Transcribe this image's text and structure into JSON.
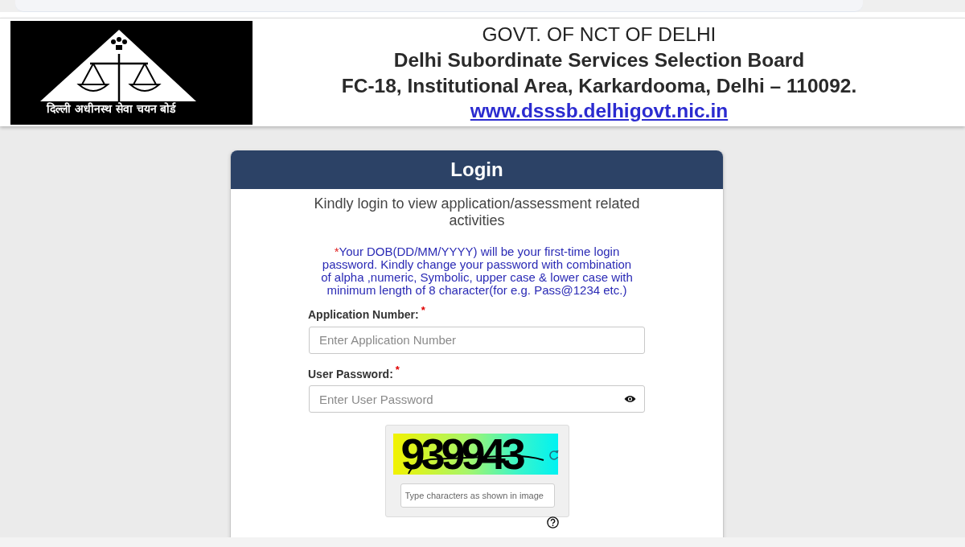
{
  "header": {
    "logo": {
      "tagline": "दिल्ली अधीनस्थ सेवा चयन बोर्ड"
    },
    "lines": [
      "GOVT. OF NCT OF DELHI",
      "Delhi Subordinate Services Selection Board",
      "FC-18, Institutional Area, Karkardooma, Delhi – 110092."
    ],
    "link": "www.dsssb.delhigovt.nic.in"
  },
  "login": {
    "title": "Login",
    "intro": "Kindly login to view application/assessment related activities",
    "note": {
      "mark": "*",
      "text": "Your DOB(DD/MM/YYYY) will be your first-time login password. Kindly change your password with combination of alpha ,numeric, Symbolic, upper case & lower case with minimum length of 8 character(for e.g. Pass@1234 etc.)"
    },
    "fields": [
      {
        "kind": "text",
        "label": "Application Number:",
        "required_mark": "*",
        "placeholder": "Enter Application Number"
      },
      {
        "kind": "password",
        "label": "User Password:",
        "required_mark": "*",
        "placeholder": "Enter User Password"
      }
    ],
    "captcha": {
      "code": "939943",
      "placeholder": "Type characters as shown in image"
    }
  }
}
